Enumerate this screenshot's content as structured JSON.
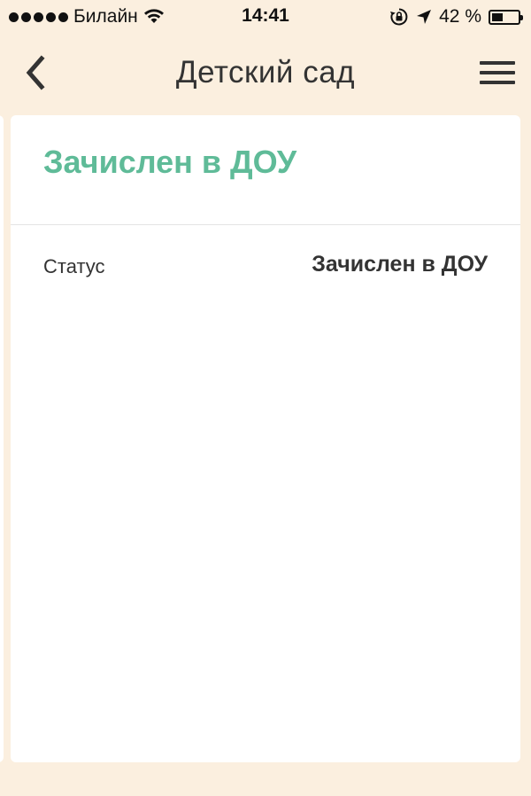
{
  "status_bar": {
    "carrier": "Билайн",
    "time": "14:41",
    "battery_percent": "42 %",
    "battery_level": 0.42,
    "icons": [
      "signal-dots",
      "wifi-icon",
      "rotation-lock-icon",
      "location-arrow-icon",
      "battery-icon"
    ]
  },
  "nav": {
    "title": "Детский сад",
    "back_icon": "chevron-left-icon",
    "menu_icon": "hamburger-menu-icon"
  },
  "card": {
    "title": "Зачислен в ДОУ",
    "rows": [
      {
        "label": "Статус",
        "value": "Зачислен в ДОУ"
      }
    ]
  },
  "colors": {
    "background": "#fbefdf",
    "accent": "#5fbb98",
    "text": "#333333"
  }
}
